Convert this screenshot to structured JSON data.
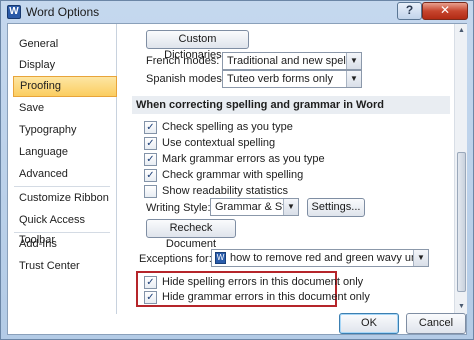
{
  "window": {
    "title": "Word Options",
    "help_glyph": "?",
    "close_glyph": "✕",
    "app_icon_glyph": "W"
  },
  "nav": {
    "items": [
      {
        "label": "General"
      },
      {
        "label": "Display"
      },
      {
        "label": "Proofing",
        "selected": true
      },
      {
        "label": "Save"
      },
      {
        "label": "Typography"
      },
      {
        "label": "Language"
      },
      {
        "label": "Advanced"
      },
      {
        "label": "Customize Ribbon"
      },
      {
        "label": "Quick Access Toolbar"
      },
      {
        "label": "Add-Ins"
      },
      {
        "label": "Trust Center"
      }
    ]
  },
  "proofing": {
    "custom_dictionaries_label": "Custom Dictionaries...",
    "french_modes": {
      "label": "French modes:",
      "value": "Traditional and new spellings"
    },
    "spanish_modes": {
      "label": "Spanish modes:",
      "value": "Tuteo verb forms only"
    },
    "section_title": "When correcting spelling and grammar in Word",
    "options": [
      {
        "label": "Check spelling as you type",
        "checked": true
      },
      {
        "label": "Use contextual spelling",
        "checked": true
      },
      {
        "label": "Mark grammar errors as you type",
        "checked": true
      },
      {
        "label": "Check grammar with spelling",
        "checked": true
      },
      {
        "label": "Show readability statistics",
        "checked": false
      }
    ],
    "writing_style": {
      "label": "Writing Style:",
      "value": "Grammar & Style"
    },
    "settings_label": "Settings...",
    "recheck_label": "Recheck Document",
    "exceptions": {
      "label": "Exceptions for:",
      "value": "how to remove red and green wavy unde..."
    },
    "exception_options": [
      {
        "label": "Hide spelling errors in this document only",
        "checked": true
      },
      {
        "label": "Hide grammar errors in this document only",
        "checked": true
      }
    ]
  },
  "footer": {
    "ok_label": "OK",
    "cancel_label": "Cancel"
  },
  "glyphs": {
    "checkmark": "✓",
    "dropdown": "▼",
    "scroll_up": "▲",
    "scroll_down": "▼"
  },
  "colors": {
    "selected_nav": "#fbcd60",
    "highlight_border": "#b5252a",
    "section_header": "#e9edf2"
  }
}
